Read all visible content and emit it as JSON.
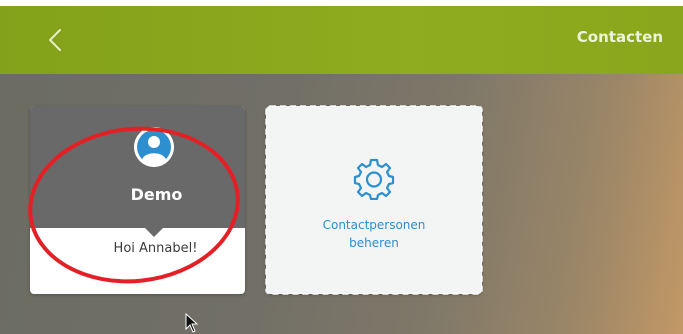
{
  "header": {
    "title": "Contacten",
    "back_icon": "chevron-left-icon"
  },
  "contact_card": {
    "name": "Demo",
    "greeting": "Hoi Annabel!",
    "avatar_icon": "user-avatar-icon"
  },
  "manage_card": {
    "label_line1": "Contactpersonen",
    "label_line2": "beheren",
    "icon": "gear-icon"
  },
  "colors": {
    "header_green": "#8aa61c",
    "card_dark": "#696969",
    "link_blue": "#2b8fd0",
    "annotation_red": "#e32026"
  }
}
